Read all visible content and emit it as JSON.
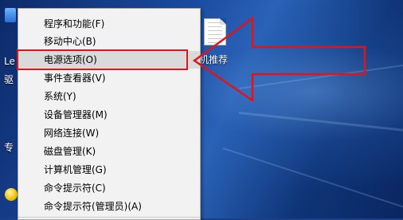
{
  "context_menu": {
    "items": [
      {
        "label": "程序和功能(F)"
      },
      {
        "label": "移动中心(B)"
      },
      {
        "label": "电源选项(O)"
      },
      {
        "label": "事件查看器(V)"
      },
      {
        "label": "系统(Y)"
      },
      {
        "label": "设备管理器(M)"
      },
      {
        "label": "网络连接(W)"
      },
      {
        "label": "磁盘管理(K)"
      },
      {
        "label": "计算机管理(G)"
      },
      {
        "label": "命令提示符(C)"
      },
      {
        "label": "命令提示符(管理员)(A)"
      }
    ]
  },
  "desktop": {
    "left_label_1": "Le",
    "left_label_2": "驱",
    "left_label_3": "专",
    "document_label": "机推荐"
  },
  "annotation": {
    "color": "#e0141b"
  }
}
